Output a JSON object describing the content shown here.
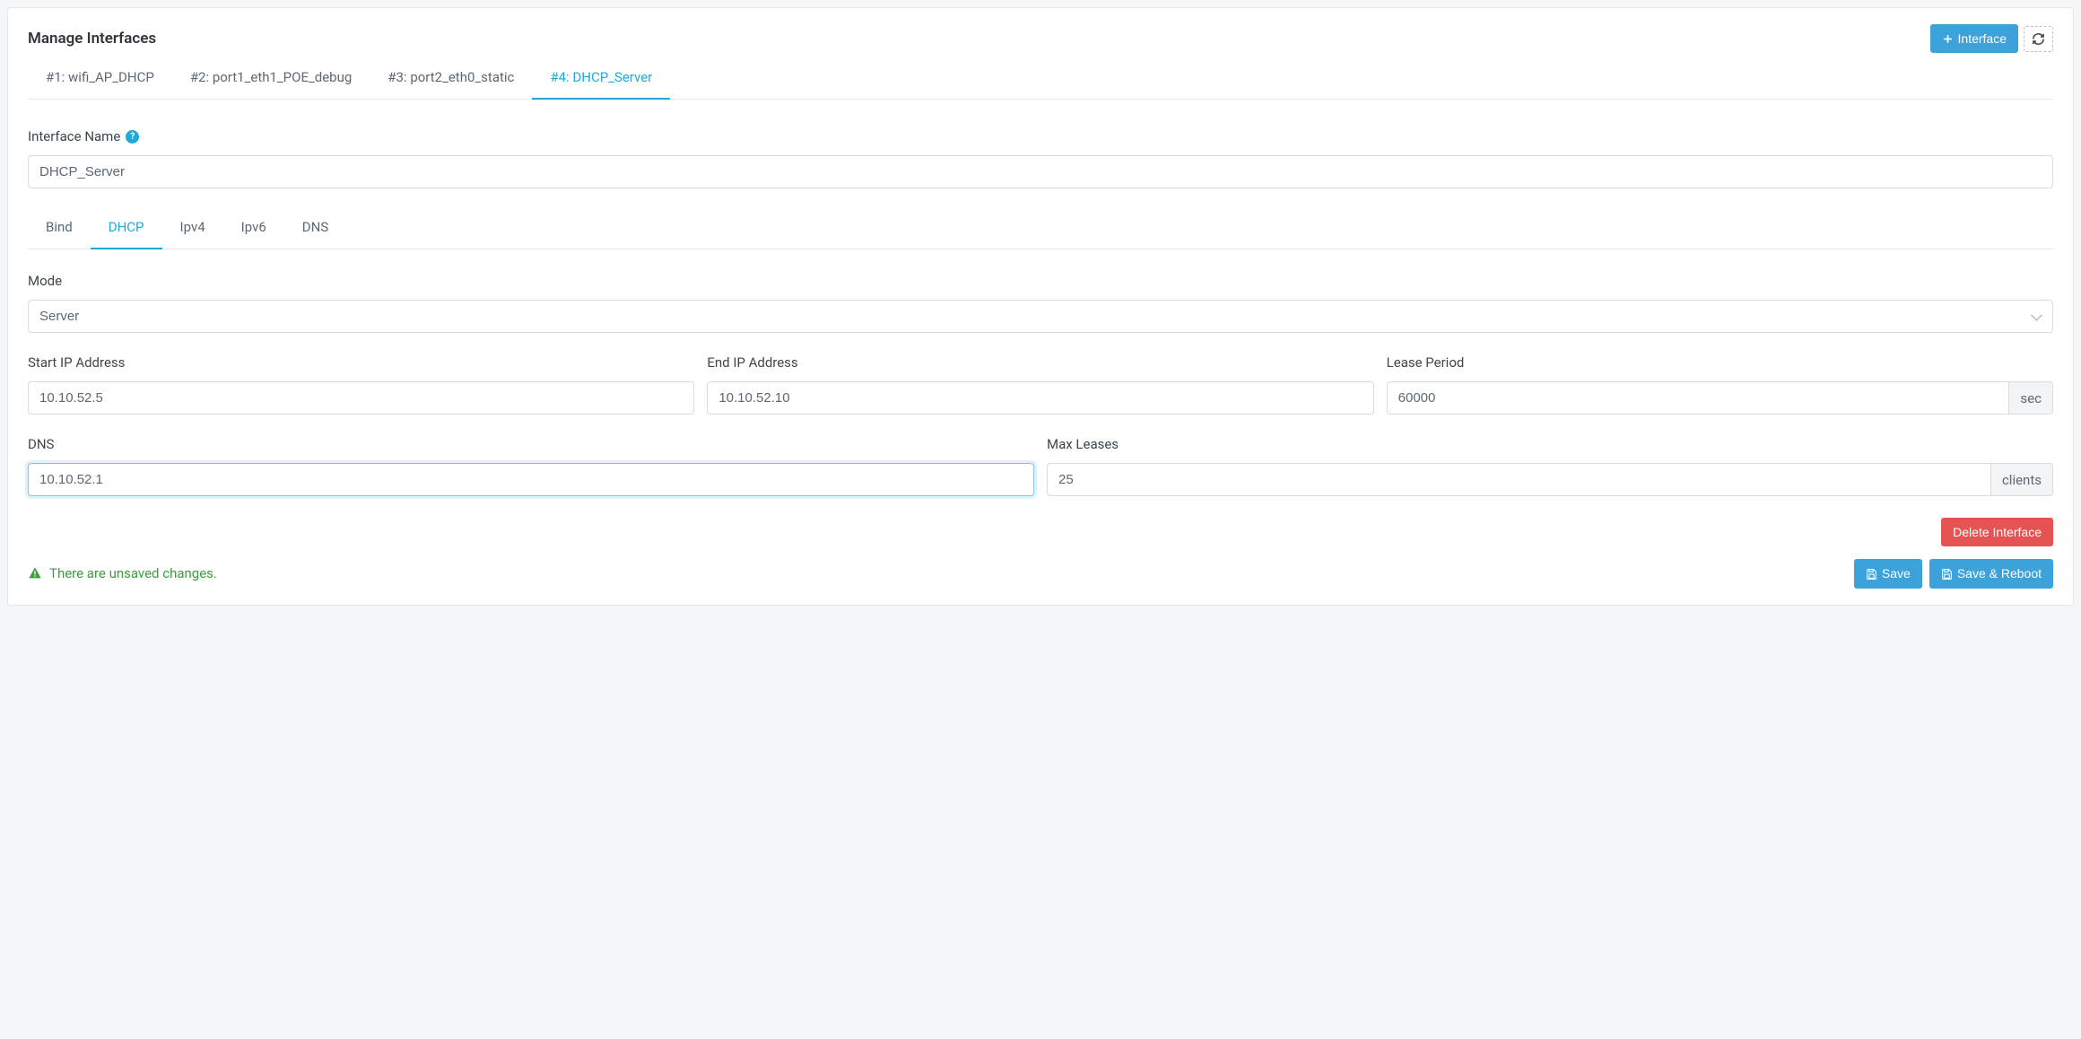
{
  "header": {
    "title": "Manage Interfaces",
    "add_button_label": "Interface"
  },
  "interface_tabs": [
    {
      "label": "#1: wifi_AP_DHCP",
      "active": false
    },
    {
      "label": "#2: port1_eth1_POE_debug",
      "active": false
    },
    {
      "label": "#3: port2_eth0_static",
      "active": false
    },
    {
      "label": "#4: DHCP_Server",
      "active": true
    }
  ],
  "form": {
    "name_label": "Interface Name",
    "name_value": "DHCP_Server",
    "sub_tabs": [
      {
        "label": "Bind",
        "active": false
      },
      {
        "label": "DHCP",
        "active": true
      },
      {
        "label": "Ipv4",
        "active": false
      },
      {
        "label": "Ipv6",
        "active": false
      },
      {
        "label": "DNS",
        "active": false
      }
    ],
    "mode_label": "Mode",
    "mode_value": "Server",
    "start_ip_label": "Start IP Address",
    "start_ip_value": "10.10.52.5",
    "end_ip_label": "End IP Address",
    "end_ip_value": "10.10.52.10",
    "lease_label": "Lease Period",
    "lease_value": "60000",
    "lease_suffix": "sec",
    "dns_label": "DNS",
    "dns_value": "10.10.52.1",
    "max_leases_label": "Max Leases",
    "max_leases_value": "25",
    "max_leases_suffix": "clients"
  },
  "footer": {
    "delete_label": "Delete Interface",
    "unsaved_text": "There are unsaved changes.",
    "save_label": "Save",
    "save_reboot_label": "Save & Reboot"
  }
}
